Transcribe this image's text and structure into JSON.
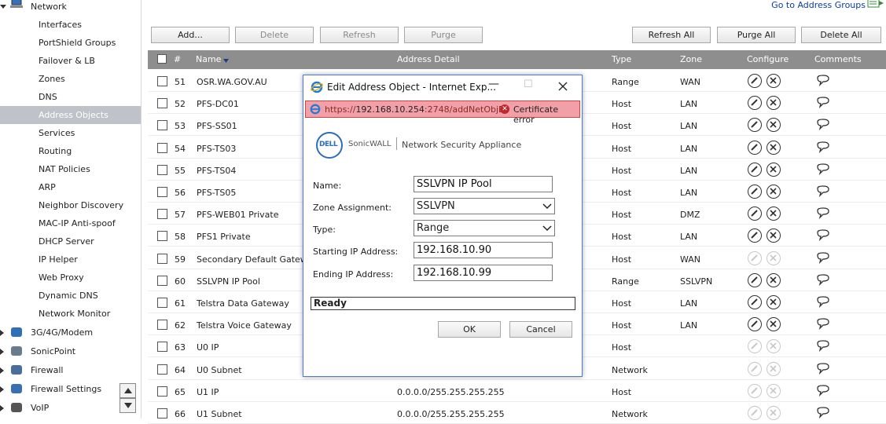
{
  "sidebar": {
    "network_label": "Network",
    "items": [
      {
        "label": "Interfaces"
      },
      {
        "label": "PortShield Groups"
      },
      {
        "label": "Failover & LB"
      },
      {
        "label": "Zones"
      },
      {
        "label": "DNS"
      },
      {
        "label": "Address Objects",
        "active": true
      },
      {
        "label": "Services"
      },
      {
        "label": "Routing"
      },
      {
        "label": "NAT Policies"
      },
      {
        "label": "ARP"
      },
      {
        "label": "Neighbor Discovery"
      },
      {
        "label": "MAC-IP Anti-spoof"
      },
      {
        "label": "DHCP Server"
      },
      {
        "label": "IP Helper"
      },
      {
        "label": "Web Proxy"
      },
      {
        "label": "Dynamic DNS"
      },
      {
        "label": "Network Monitor"
      }
    ],
    "groups": [
      {
        "label": "3G/4G/Modem",
        "icon": "modem-icon"
      },
      {
        "label": "SonicPoint",
        "icon": "sonicpoint-icon"
      },
      {
        "label": "Firewall",
        "icon": "firewall-icon"
      },
      {
        "label": "Firewall Settings",
        "icon": "firewall-settings-icon"
      },
      {
        "label": "VoIP",
        "icon": "voip-icon"
      }
    ]
  },
  "header": {
    "goto_link": "Go to Address Groups"
  },
  "toolbar": {
    "add": "Add...",
    "delete": "Delete",
    "refresh": "Refresh",
    "purge": "Purge",
    "refresh_all": "Refresh All",
    "purge_all": "Purge All",
    "delete_all": "Delete All"
  },
  "table": {
    "columns": {
      "num": "#",
      "name": "Name",
      "detail": "Address Detail",
      "type": "Type",
      "zone": "Zone",
      "configure": "Configure",
      "comments": "Comments"
    },
    "rows": [
      {
        "num": "51",
        "name": "OSR.WA.GOV.AU",
        "detail": "",
        "type": "Range",
        "zone": "WAN",
        "editable": true
      },
      {
        "num": "52",
        "name": "PFS-DC01",
        "detail": "",
        "type": "Host",
        "zone": "LAN",
        "editable": true
      },
      {
        "num": "53",
        "name": "PFS-SS01",
        "detail": "",
        "type": "Host",
        "zone": "LAN",
        "editable": true
      },
      {
        "num": "54",
        "name": "PFS-TS03",
        "detail": "",
        "type": "Host",
        "zone": "LAN",
        "editable": true
      },
      {
        "num": "55",
        "name": "PFS-TS04",
        "detail": "",
        "type": "Host",
        "zone": "LAN",
        "editable": true
      },
      {
        "num": "56",
        "name": "PFS-TS05",
        "detail": "",
        "type": "Host",
        "zone": "LAN",
        "editable": true
      },
      {
        "num": "57",
        "name": "PFS-WEB01 Private",
        "detail": "",
        "type": "Host",
        "zone": "DMZ",
        "editable": true
      },
      {
        "num": "58",
        "name": "PFS1 Private",
        "detail": "",
        "type": "Host",
        "zone": "LAN",
        "editable": true
      },
      {
        "num": "59",
        "name": "Secondary Default Gateway",
        "detail": "",
        "type": "Host",
        "zone": "WAN",
        "editable": false
      },
      {
        "num": "60",
        "name": "SSLVPN IP Pool",
        "detail": "",
        "type": "Range",
        "zone": "SSLVPN",
        "editable": true
      },
      {
        "num": "61",
        "name": "Telstra Data Gateway",
        "detail": "",
        "type": "Host",
        "zone": "LAN",
        "editable": true
      },
      {
        "num": "62",
        "name": "Telstra Voice Gateway",
        "detail": "",
        "type": "Host",
        "zone": "LAN",
        "editable": true
      },
      {
        "num": "63",
        "name": "U0 IP",
        "detail": "",
        "type": "Host",
        "zone": "",
        "editable": false
      },
      {
        "num": "64",
        "name": "U0 Subnet",
        "detail": "",
        "type": "Network",
        "zone": "",
        "editable": false
      },
      {
        "num": "65",
        "name": "U1 IP",
        "detail": "0.0.0.0/255.255.255.255",
        "type": "Host",
        "zone": "",
        "editable": false
      },
      {
        "num": "66",
        "name": "U1 Subnet",
        "detail": "0.0.0.0/255.255.255.255",
        "type": "Network",
        "zone": "",
        "editable": false
      }
    ]
  },
  "dialog": {
    "title": "Edit Address Object - Internet Exp...",
    "url_prefix": "https://",
    "url_host": "192.168.10.254",
    "url_rest": ":2748/addNetObjD",
    "cert_error": "Certificate error",
    "brand": "SonicWALL",
    "brand_sub": "Network Security Appliance",
    "logo_text": "DELL",
    "fields": {
      "name_label": "Name:",
      "name_value": "SSLVPN IP Pool",
      "zone_label": "Zone Assignment:",
      "zone_value": "SSLVPN",
      "type_label": "Type:",
      "type_value": "Range",
      "start_label": "Starting IP Address:",
      "start_value": "192.168.10.90",
      "end_label": "Ending IP Address:",
      "end_value": "192.168.10.99"
    },
    "status": "Ready",
    "ok": "OK",
    "cancel": "Cancel"
  }
}
